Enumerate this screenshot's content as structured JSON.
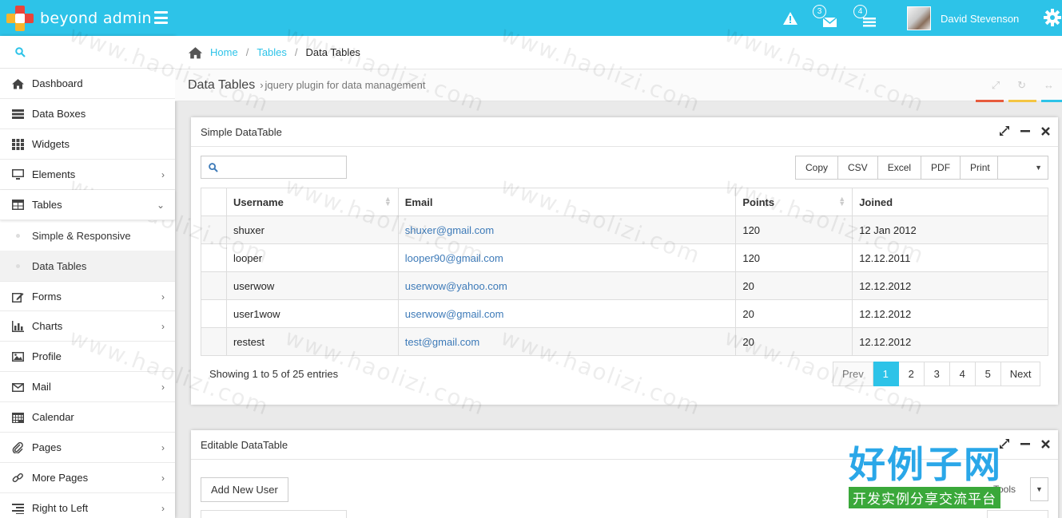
{
  "brand": {
    "name": "beyond admin"
  },
  "navbar": {
    "notifications_badge": "",
    "messages_badge": "3",
    "tasks_badge": "4",
    "user_name": "David Stevenson"
  },
  "sidebar": {
    "items": [
      {
        "label": "Dashboard",
        "icon": "home-icon",
        "has_children": false
      },
      {
        "label": "Data Boxes",
        "icon": "tasks-icon",
        "has_children": false
      },
      {
        "label": "Widgets",
        "icon": "grid-icon",
        "has_children": false
      },
      {
        "label": "Elements",
        "icon": "desktop-icon",
        "has_children": true
      },
      {
        "label": "Tables",
        "icon": "table-icon",
        "has_children": true,
        "open": true,
        "children": [
          {
            "label": "Simple & Responsive"
          },
          {
            "label": "Data Tables",
            "active": true
          }
        ]
      },
      {
        "label": "Forms",
        "icon": "pencil-square-icon",
        "has_children": true
      },
      {
        "label": "Charts",
        "icon": "bar-chart-icon",
        "has_children": true
      },
      {
        "label": "Profile",
        "icon": "picture-icon",
        "has_children": false
      },
      {
        "label": "Mail",
        "icon": "envelope-icon",
        "has_children": true
      },
      {
        "label": "Calendar",
        "icon": "calendar-icon",
        "has_children": false
      },
      {
        "label": "Pages",
        "icon": "paperclip-icon",
        "has_children": true
      },
      {
        "label": "More Pages",
        "icon": "link-icon",
        "has_children": true
      },
      {
        "label": "Right to Left",
        "icon": "align-right-icon",
        "has_children": true
      }
    ]
  },
  "breadcrumb": {
    "home": "Home",
    "tables": "Tables",
    "current": "Data Tables"
  },
  "page_header": {
    "title": "Data Tables",
    "subtitle": "jquery plugin for data management"
  },
  "colors": {
    "accent": "#2dc3e8",
    "bar1": "#e75b3d",
    "bar2": "#f4c542",
    "bar3": "#2dc3e8"
  },
  "simple_table": {
    "caption": "Simple DataTable",
    "search_placeholder": "",
    "export_buttons": [
      "Copy",
      "CSV",
      "Excel",
      "PDF",
      "Print"
    ],
    "columns": [
      "Username",
      "Email",
      "Points",
      "Joined"
    ],
    "rows": [
      [
        "shuxer",
        "shuxer@gmail.com",
        "120",
        "12 Jan 2012"
      ],
      [
        "looper",
        "looper90@gmail.com",
        "120",
        "12.12.2011"
      ],
      [
        "userwow",
        "userwow@yahoo.com",
        "20",
        "12.12.2012"
      ],
      [
        "user1wow",
        "userwow@gmail.com",
        "20",
        "12.12.2012"
      ],
      [
        "restest",
        "test@gmail.com",
        "20",
        "12.12.2012"
      ]
    ],
    "info": "Showing 1 to 5 of 25 entries",
    "pager": {
      "prev": "Prev",
      "pages": [
        "1",
        "2",
        "3",
        "4",
        "5"
      ],
      "next": "Next",
      "active": "1"
    }
  },
  "editable_table": {
    "caption": "Editable DataTable",
    "add_button": "Add New User",
    "tools_label": "Tools"
  },
  "watermark": {
    "text": "www.haolizi.com",
    "logo_big": "好例子网",
    "logo_small": "开发实例分享交流平台"
  }
}
